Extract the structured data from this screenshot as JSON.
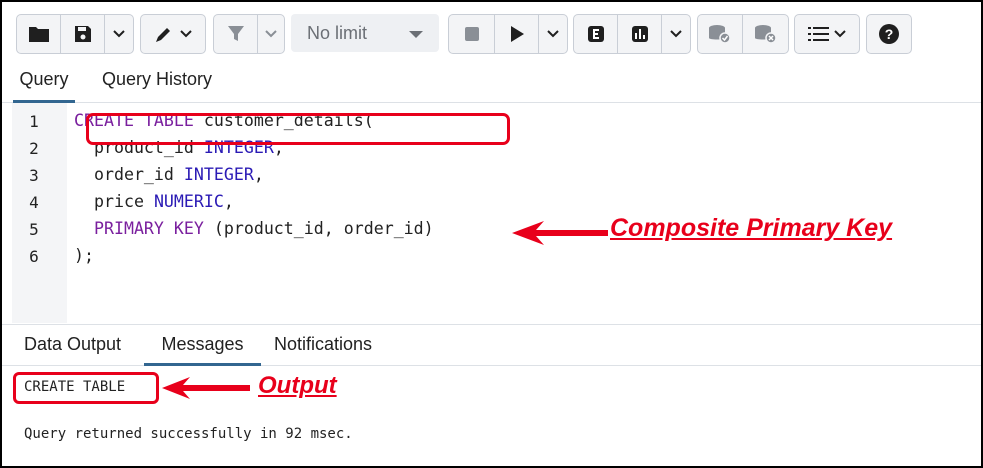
{
  "toolbar": {
    "limit_label": "No limit",
    "icons": [
      "open-folder-icon",
      "save-icon",
      "chevron-down-icon",
      "edit-pen-icon",
      "filter-icon",
      "stop-icon",
      "play-icon",
      "explain-icon",
      "explain-analyze-icon",
      "commit-icon",
      "rollback-icon",
      "macros-icon",
      "help-icon"
    ]
  },
  "query_tabs": [
    "Query",
    "Query History"
  ],
  "editor": {
    "line_numbers": [
      "1",
      "2",
      "3",
      "4",
      "5",
      "6"
    ],
    "lines": [
      {
        "kw": "CREATE TABLE",
        "rest": " customer_details("
      },
      {
        "pre": "  product_id ",
        "type": "INTEGER",
        "post": ","
      },
      {
        "pre": "  order_id ",
        "type": "INTEGER",
        "post": ","
      },
      {
        "pre": "  price ",
        "type": "NUMERIC",
        "post": ","
      },
      {
        "kw": "  PRIMARY KEY",
        "rest": " (product_id, order_id)"
      },
      {
        "rest": ");"
      }
    ]
  },
  "result_tabs": [
    "Data Output",
    "Messages",
    "Notifications"
  ],
  "messages": {
    "line1": "CREATE TABLE",
    "line2": "Query returned successfully in 92 msec."
  },
  "annotations": {
    "composite": "Composite Primary Key",
    "output": "Output",
    "color": "#e8001b"
  },
  "colors": {
    "keyword": "#7a1f9e",
    "type": "#2b1bb5",
    "active_tab": "#326690"
  }
}
